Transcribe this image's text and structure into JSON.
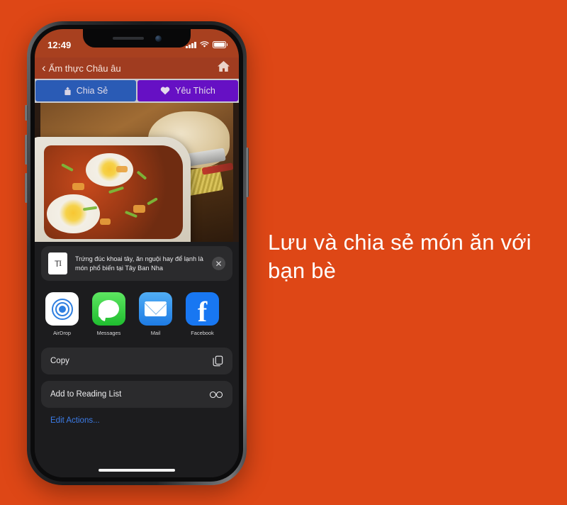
{
  "background": {
    "color": "#DE4716"
  },
  "caption": {
    "text": "Lưu và chia sẻ món ăn với bạn bè"
  },
  "phone": {
    "status_bar": {
      "time": "12:49",
      "icons": {
        "signal": "cellular-signal-icon",
        "wifi": "wifi-icon",
        "battery": "battery-icon"
      }
    },
    "nav_bar": {
      "back_label": "Ẩm thực Châu âu",
      "back_chevron": "‹",
      "home_icon": "home-icon"
    },
    "action_bar": {
      "share": {
        "label": "Chia Sẻ",
        "icon": "share-icon",
        "color": "#2A5BB5"
      },
      "favorite": {
        "label": "Yêu Thích",
        "icon": "heart-icon",
        "color": "#6610C4"
      }
    },
    "photo": {
      "alt": "Trứng đúc khoai tây với bánh mì"
    },
    "share_sheet": {
      "preview": {
        "thumb_icon": "text-document-icon",
        "thumb_glyph": "T",
        "text": "Trứng đúc khoai tây, ăn nguội hay để lạnh là món phổ biến tại Tây Ban Nha",
        "close_icon": "close-icon",
        "close_glyph": "✕"
      },
      "apps": [
        {
          "label": "AirDrop",
          "icon": "airdrop-icon"
        },
        {
          "label": "Messages",
          "icon": "messages-icon"
        },
        {
          "label": "Mail",
          "icon": "mail-icon"
        },
        {
          "label": "Facebook",
          "icon": "facebook-icon"
        },
        {
          "label": "",
          "icon": "messenger-icon"
        }
      ],
      "actions": [
        {
          "label": "Copy",
          "icon": "copy-icon"
        },
        {
          "label": "Add to Reading List",
          "icon": "glasses-icon"
        }
      ],
      "edit_actions_label": "Edit Actions..."
    }
  }
}
